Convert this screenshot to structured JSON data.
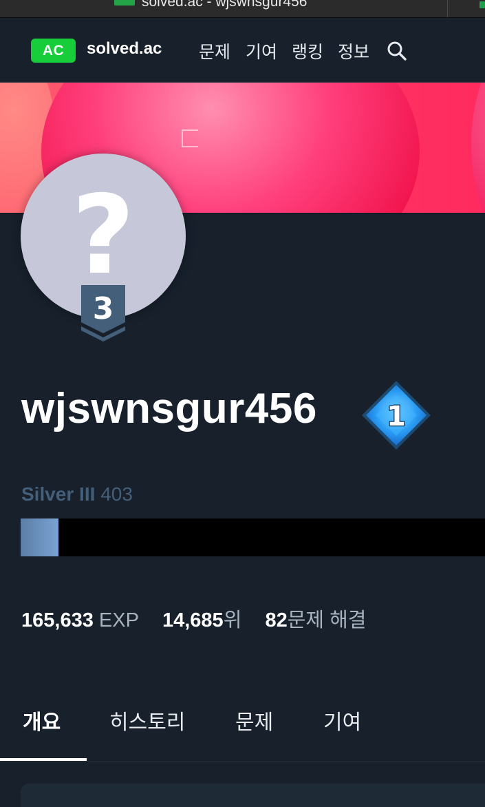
{
  "browser": {
    "tab_title": "solved.ac - wjswnsgur456"
  },
  "nav": {
    "logo_badge": "AC",
    "logo_text": "solved.ac",
    "items": [
      {
        "label": "문제"
      },
      {
        "label": "기여"
      },
      {
        "label": "랭킹"
      },
      {
        "label": "정보"
      }
    ],
    "search_icon": "search-icon"
  },
  "profile": {
    "avatar_placeholder": "?",
    "tier_level": "3",
    "username": "wjswnsgur456",
    "rank_badge_level": "1",
    "tier_name": "Silver III",
    "rating": "403",
    "progress_fraction": 0.082,
    "stats": {
      "exp_value": "165,633",
      "exp_unit": "EXP",
      "rank_value": "14,685",
      "rank_unit": "위",
      "solved_value": "82",
      "solved_unit": "문제 해결"
    }
  },
  "tabs": [
    {
      "label": "개요",
      "active": true
    },
    {
      "label": "히스토리",
      "active": false
    },
    {
      "label": "문제",
      "active": false
    },
    {
      "label": "기여",
      "active": false
    }
  ],
  "colors": {
    "background": "#17202b",
    "logo_green": "#17ce3a",
    "silver_tier": "#435f7a",
    "progress_fill": "#5b7ea6",
    "rank_diamond": "#2a9df4"
  }
}
